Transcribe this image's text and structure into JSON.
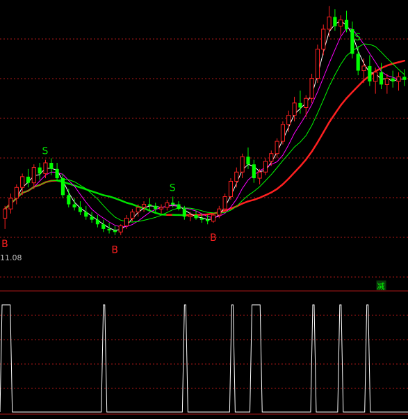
{
  "chart_data": {
    "type": "candlestick",
    "candles": [
      [
        12.0,
        12.8,
        11.3,
        12.6
      ],
      [
        12.6,
        13.6,
        12.3,
        13.3
      ],
      [
        13.3,
        14.2,
        12.9,
        14.0
      ],
      [
        14.0,
        14.9,
        13.5,
        14.7
      ],
      [
        14.7,
        15.2,
        14.0,
        14.3
      ],
      [
        14.3,
        15.5,
        13.9,
        15.3
      ],
      [
        15.3,
        15.6,
        14.5,
        14.9
      ],
      [
        14.9,
        15.8,
        14.6,
        15.6
      ],
      [
        15.6,
        15.9,
        14.8,
        15.2
      ],
      [
        15.2,
        15.6,
        14.4,
        14.6
      ],
      [
        14.6,
        14.9,
        13.3,
        13.5
      ],
      [
        13.5,
        13.9,
        12.7,
        12.9
      ],
      [
        12.9,
        13.3,
        12.5,
        12.7
      ],
      [
        12.7,
        13.1,
        12.2,
        12.4
      ],
      [
        12.4,
        12.8,
        11.9,
        12.1
      ],
      [
        12.1,
        12.4,
        11.7,
        11.9
      ],
      [
        11.9,
        12.2,
        11.4,
        11.6
      ],
      [
        11.6,
        11.9,
        11.1,
        11.3
      ],
      [
        11.3,
        11.7,
        11.0,
        11.2
      ],
      [
        11.2,
        11.5,
        10.9,
        11.1
      ],
      [
        11.1,
        11.6,
        10.9,
        11.5
      ],
      [
        11.5,
        12.2,
        11.3,
        12.0
      ],
      [
        12.0,
        12.6,
        11.8,
        12.4
      ],
      [
        12.4,
        12.9,
        12.1,
        12.7
      ],
      [
        12.7,
        13.1,
        12.4,
        12.9
      ],
      [
        12.9,
        13.3,
        12.5,
        12.8
      ],
      [
        12.8,
        13.0,
        12.4,
        12.6
      ],
      [
        12.6,
        12.9,
        12.3,
        12.7
      ],
      [
        12.7,
        13.2,
        12.5,
        13.0
      ],
      [
        13.0,
        13.4,
        12.7,
        12.9
      ],
      [
        12.9,
        13.1,
        12.5,
        12.6
      ],
      [
        12.6,
        12.8,
        11.9,
        12.1
      ],
      [
        12.1,
        12.4,
        11.8,
        12.2
      ],
      [
        12.2,
        12.5,
        11.9,
        12.0
      ],
      [
        12.0,
        12.3,
        11.7,
        11.9
      ],
      [
        11.9,
        12.2,
        11.6,
        11.8
      ],
      [
        11.8,
        12.3,
        11.7,
        12.2
      ],
      [
        12.2,
        12.8,
        12.0,
        12.6
      ],
      [
        12.6,
        13.6,
        12.4,
        13.4
      ],
      [
        13.4,
        14.6,
        13.2,
        14.4
      ],
      [
        14.4,
        15.3,
        14.0,
        15.0
      ],
      [
        15.0,
        16.2,
        14.6,
        16.0
      ],
      [
        16.0,
        16.6,
        15.2,
        15.5
      ],
      [
        15.5,
        15.8,
        14.3,
        14.6
      ],
      [
        14.6,
        15.2,
        14.2,
        15.0
      ],
      [
        15.0,
        15.9,
        14.8,
        15.7
      ],
      [
        15.7,
        16.4,
        15.4,
        16.2
      ],
      [
        16.2,
        17.2,
        15.9,
        17.0
      ],
      [
        17.0,
        18.3,
        16.8,
        18.1
      ],
      [
        18.1,
        19.0,
        17.6,
        18.7
      ],
      [
        18.7,
        19.9,
        18.3,
        19.5
      ],
      [
        19.5,
        20.3,
        18.8,
        19.2
      ],
      [
        19.2,
        20.0,
        18.6,
        19.8
      ],
      [
        19.8,
        21.4,
        19.5,
        21.1
      ],
      [
        21.1,
        23.3,
        20.8,
        23.0
      ],
      [
        23.0,
        24.6,
        22.6,
        24.3
      ],
      [
        24.3,
        25.8,
        23.8,
        25.1
      ],
      [
        25.1,
        25.6,
        24.2,
        24.5
      ],
      [
        24.5,
        25.2,
        23.9,
        24.9
      ],
      [
        24.9,
        25.5,
        24.1,
        24.3
      ],
      [
        24.3,
        24.8,
        22.4,
        22.7
      ],
      [
        22.7,
        23.2,
        21.3,
        21.6
      ],
      [
        21.6,
        22.4,
        20.8,
        21.9
      ],
      [
        21.9,
        22.6,
        20.6,
        20.9
      ],
      [
        20.9,
        21.8,
        20.1,
        21.5
      ],
      [
        21.5,
        22.1,
        20.4,
        20.7
      ],
      [
        20.7,
        21.4,
        20.1,
        21.1
      ],
      [
        21.1,
        21.6,
        20.5,
        20.9
      ],
      [
        20.9,
        21.5,
        20.3,
        21.2
      ],
      [
        21.2,
        21.7,
        20.6,
        21.0
      ]
    ],
    "ma_series": [
      {
        "color": "#ffffff"
      },
      {
        "color": "#ff00ff"
      },
      {
        "color": "#00ff00"
      }
    ],
    "trend_line": {
      "up_color": "#ff2020",
      "down_color": "#00e000"
    },
    "price_label": "11.08",
    "signals": [
      {
        "text": "S",
        "index": 7,
        "color": "#00e000"
      },
      {
        "text": "B",
        "index": 0,
        "color": "#ff2020"
      },
      {
        "text": "B",
        "index": 19,
        "color": "#ff2020"
      },
      {
        "text": "S",
        "index": 29,
        "color": "#00e000"
      },
      {
        "text": "B",
        "index": 36,
        "color": "#ff2020"
      },
      {
        "text": "S",
        "index": 61,
        "color": "#00e000"
      }
    ],
    "reduce_marker": {
      "text": "减",
      "color": "#00ff00",
      "index": 65
    },
    "indicator_pulses": [
      [
        0,
        1
      ],
      [
        15,
        15
      ],
      [
        27,
        27
      ],
      [
        34,
        34
      ],
      [
        37,
        38
      ],
      [
        46,
        46
      ],
      [
        50,
        50
      ],
      [
        54,
        54
      ]
    ],
    "colors": {
      "up": "#ff2020",
      "down": "#00ff00",
      "grid": "#b01818",
      "background": "#000000"
    }
  }
}
